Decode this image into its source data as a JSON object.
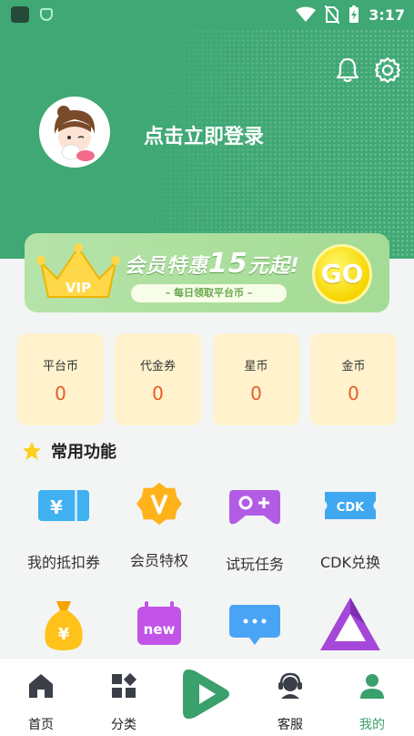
{
  "status_bar": {
    "time": "3:17"
  },
  "header": {
    "login_text": "点击立即登录"
  },
  "vip_banner": {
    "title_prefix": "会员特惠",
    "title_number": "15",
    "title_suffix": "元起!",
    "subtitle": "– 每日领取平台币 –",
    "go_label": "GO",
    "crown_text": "VIP"
  },
  "currencies": [
    {
      "label": "平台币",
      "value": "0"
    },
    {
      "label": "代金券",
      "value": "0"
    },
    {
      "label": "星币",
      "value": "0"
    },
    {
      "label": "金币",
      "value": "0"
    }
  ],
  "section": {
    "title": "常用功能"
  },
  "features": [
    {
      "label": "我的抵扣券",
      "icon": "voucher-icon"
    },
    {
      "label": "会员特权",
      "icon": "vip-badge-icon"
    },
    {
      "label": "试玩任务",
      "icon": "gamepad-icon"
    },
    {
      "label": "CDK兑换",
      "icon": "cdk-ticket-icon"
    },
    {
      "label": "",
      "icon": "money-bag-icon"
    },
    {
      "label": "",
      "icon": "new-calendar-icon"
    },
    {
      "label": "",
      "icon": "message-icon"
    },
    {
      "label": "",
      "icon": "triangle-icon"
    }
  ],
  "cdk_text": "CDK",
  "new_text": "new",
  "nav": {
    "items": [
      {
        "label": "首页",
        "icon": "home-icon"
      },
      {
        "label": "分类",
        "icon": "category-icon"
      },
      {
        "label": "",
        "icon": "play-icon"
      },
      {
        "label": "客服",
        "icon": "customer-service-icon"
      },
      {
        "label": "我的",
        "icon": "profile-icon"
      }
    ],
    "active_index": 4
  },
  "colors": {
    "brand_green": "#3fa874",
    "accent_orange": "#e85c2a",
    "card_bg": "#fff2cc"
  }
}
